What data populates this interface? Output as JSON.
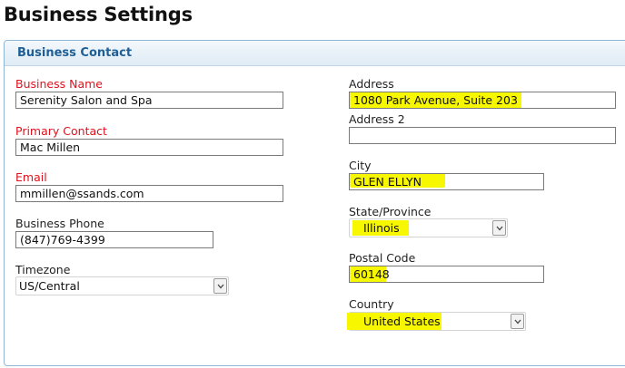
{
  "page": {
    "title": "Business Settings"
  },
  "panel": {
    "title": "Business Contact"
  },
  "left": {
    "business_name": {
      "label": "Business Name",
      "value": "Serenity Salon and Spa"
    },
    "primary_contact": {
      "label": "Primary Contact",
      "value": "Mac Millen"
    },
    "email": {
      "label": "Email",
      "value": "mmillen@ssands.com"
    },
    "business_phone": {
      "label": "Business Phone",
      "value": "(847)769-4399"
    },
    "timezone": {
      "label": "Timezone",
      "value": "US/Central"
    }
  },
  "right": {
    "address": {
      "label": "Address",
      "value": "1080 Park Avenue, Suite 203"
    },
    "address2": {
      "label": "Address 2",
      "value": ""
    },
    "city": {
      "label": "City",
      "value": "GLEN ELLYN"
    },
    "state": {
      "label": "State/Province",
      "value": "Illinois"
    },
    "postal_code": {
      "label": "Postal Code",
      "value": "60148"
    },
    "country": {
      "label": "Country",
      "value": "United States"
    }
  },
  "colors": {
    "required_label": "#e0121e",
    "panel_title": "#1f5f96",
    "highlight": "#f7f700"
  },
  "icons": {
    "dropdown": "chevron-down-icon"
  }
}
